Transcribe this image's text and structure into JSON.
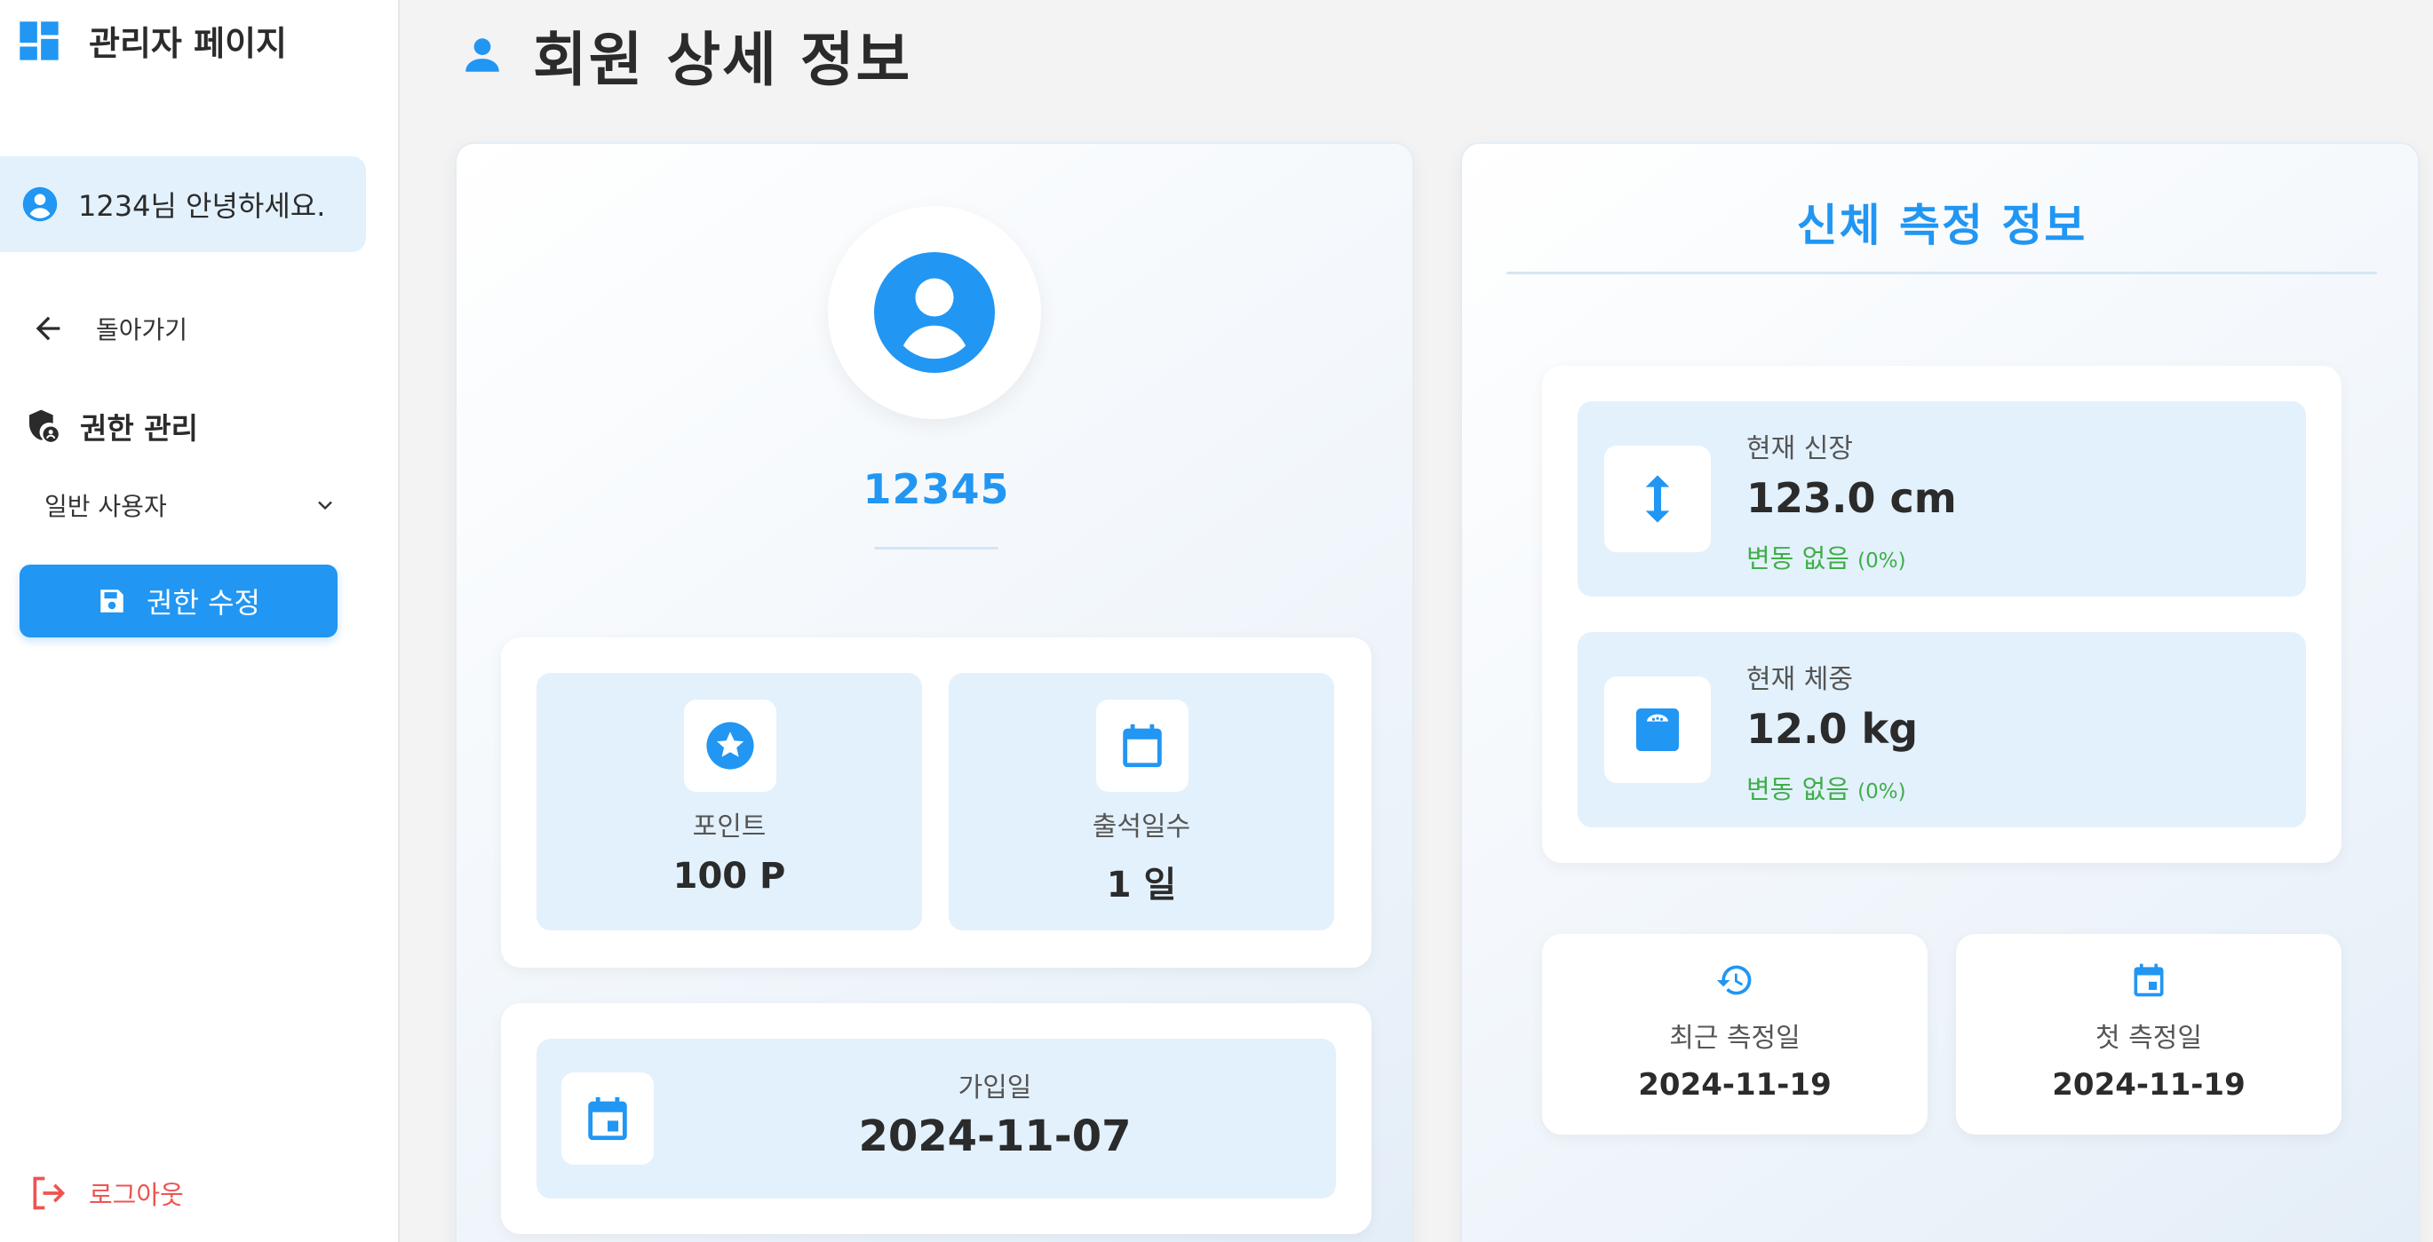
{
  "sidebar": {
    "title": "관리자 페이지",
    "greeting_name": "1234",
    "greeting_suffix": "님 안녕하세요.",
    "back_label": "돌아가기",
    "permission_title": "권한 관리",
    "role_selected": "일반 사용자",
    "save_button_label": "권한 수정",
    "logout_label": "로그아웃"
  },
  "page": {
    "title": "회원 상세 정보"
  },
  "profile": {
    "member_id": "12345",
    "points_label": "포인트",
    "points_value": "100 P",
    "attendance_label": "출석일수",
    "attendance_value": "1 일",
    "join_label": "가입일",
    "join_value": "2024-11-07"
  },
  "body": {
    "title": "신체 측정 정보",
    "height_label": "현재 신장",
    "height_value": "123.0 cm",
    "height_change": "변동 없음",
    "height_change_pct": "(0%)",
    "weight_label": "현재 체중",
    "weight_value": "12.0 kg",
    "weight_change": "변동 없음",
    "weight_change_pct": "(0%)",
    "recent_label": "최근 측정일",
    "recent_value": "2024-11-19",
    "first_label": "첫 측정일",
    "first_value": "2024-11-19"
  },
  "icons": {
    "brand": "dashboard-icon",
    "greeting": "account-circle-icon",
    "back": "arrow-left-icon",
    "permission": "admin-shield-icon",
    "dropdown": "chevron-down-icon",
    "save": "floppy-disk-icon",
    "logout": "logout-icon",
    "page": "person-icon",
    "avatar": "account-circle-icon",
    "points": "star-icon",
    "attendance": "calendar-icon",
    "join": "calendar-event-icon",
    "height": "arrow-vertical-icon",
    "weight": "scale-icon",
    "recent": "history-icon",
    "first": "calendar-event-icon"
  },
  "colors": {
    "accent": "#2196f3",
    "tile_bg": "#e3f1fd",
    "success": "#3fae49",
    "danger": "#ef5350"
  }
}
